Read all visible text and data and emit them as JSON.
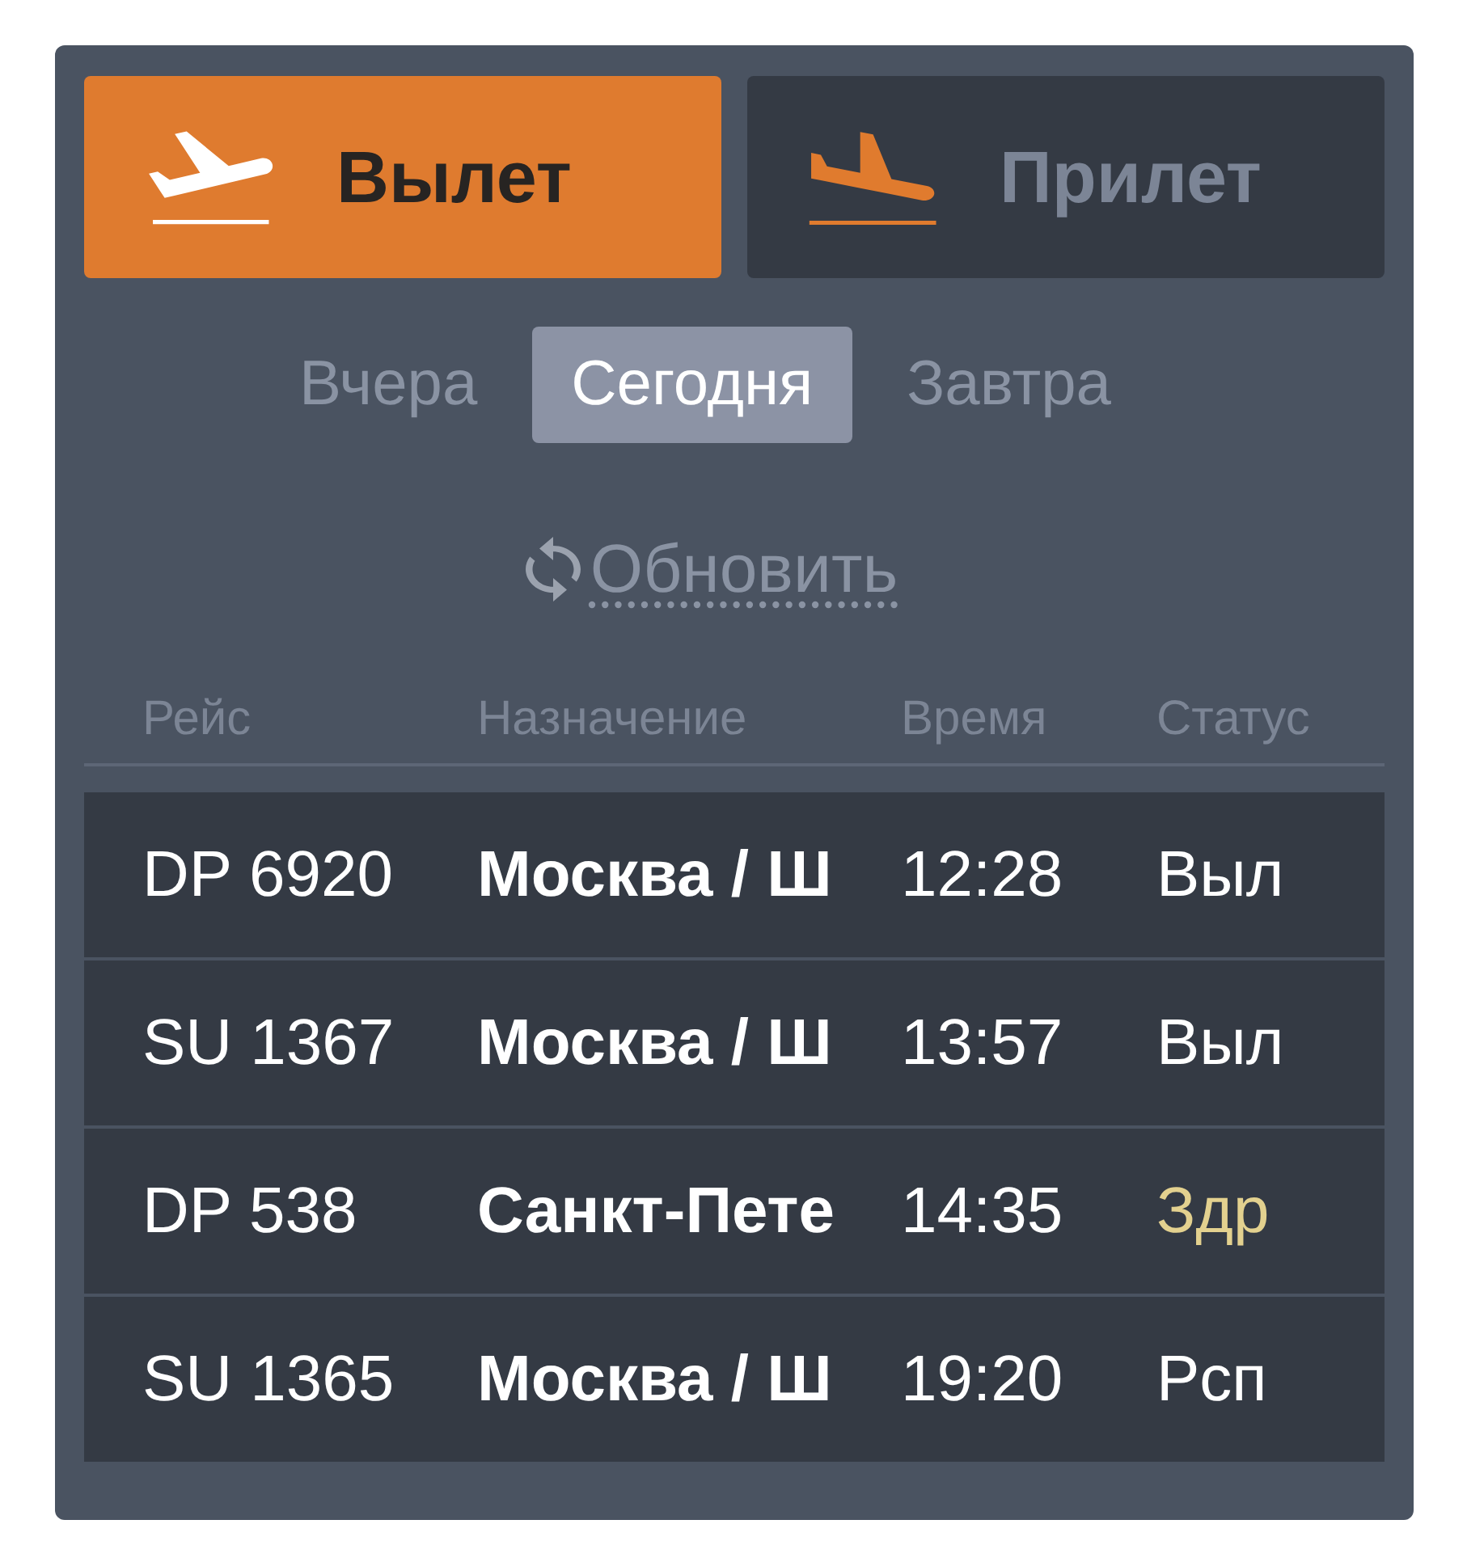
{
  "direction_tabs": [
    {
      "label": "Вылет",
      "kind": "departure",
      "selected": true
    },
    {
      "label": "Прилет",
      "kind": "arrival",
      "selected": false
    }
  ],
  "day_tabs": [
    {
      "label": "Вчера",
      "selected": false
    },
    {
      "label": "Сегодня",
      "selected": true
    },
    {
      "label": "Завтра",
      "selected": false
    }
  ],
  "refresh": {
    "label": "Обновить"
  },
  "table": {
    "columns": [
      "Рейс",
      "Назначение",
      "Время",
      "Статус"
    ],
    "rows": [
      {
        "flight": "DP 6920",
        "destination": "Москва / Ш",
        "time": "12:28",
        "status": "Выл",
        "color": "#ffffff"
      },
      {
        "flight": "SU 1367",
        "destination": "Москва / Ш",
        "time": "13:57",
        "status": "Выл",
        "color": "#ffffff"
      },
      {
        "flight": "DP 538",
        "destination": "Санкт-Пете",
        "time": "14:35",
        "status": "Здр",
        "color": "#e3d18f"
      },
      {
        "flight": "SU 1365",
        "destination": "Москва / Ш",
        "time": "19:20",
        "status": "Рсп",
        "color": "#ffffff"
      }
    ]
  }
}
